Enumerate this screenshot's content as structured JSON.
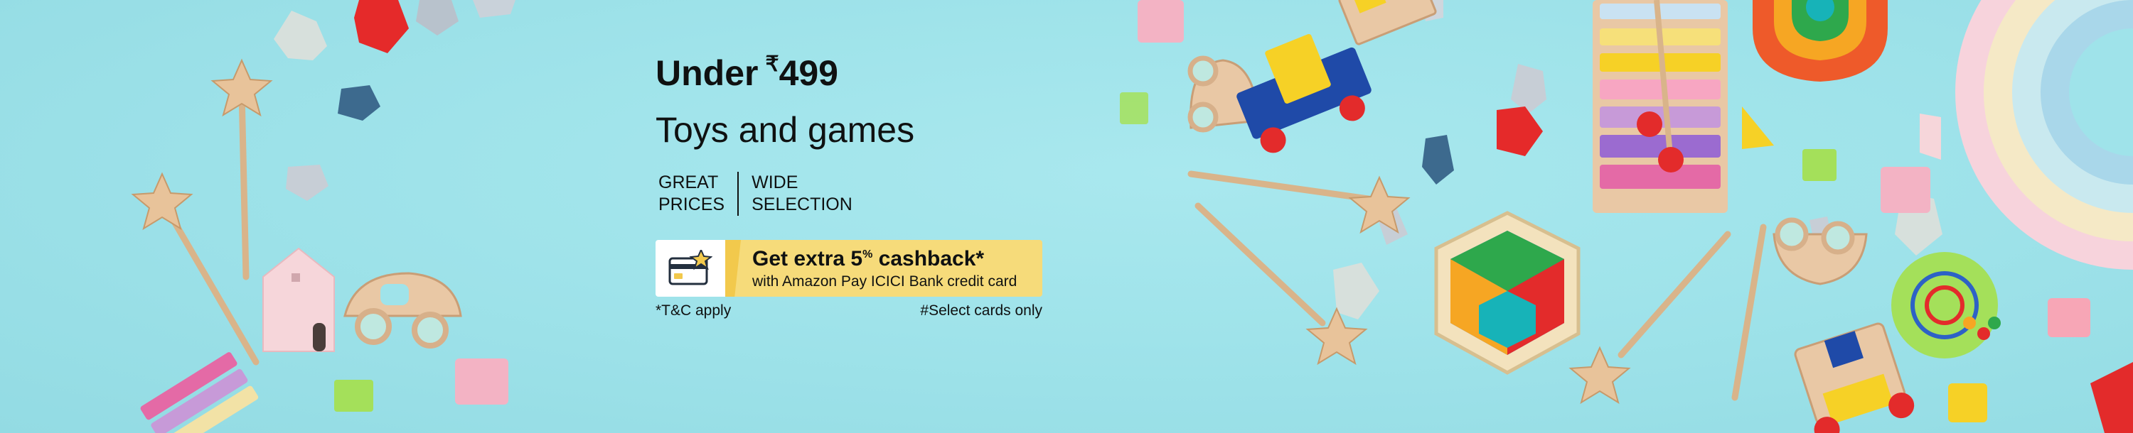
{
  "banner": {
    "price_prefix": "Under",
    "price_currency": "₹",
    "price_value": "499",
    "subtitle": "Toys and games",
    "features": [
      {
        "line1": "GREAT",
        "line2": "PRICES"
      },
      {
        "line1": "WIDE",
        "line2": "SELECTION"
      }
    ],
    "offer": {
      "title_prefix": "Get extra 5",
      "title_sup": "%",
      "title_suffix": " cashback*",
      "subtitle": "with Amazon Pay ICICI Bank credit card",
      "icon": "credit-card-star-icon"
    },
    "footnote_left": "*T&C apply",
    "footnote_right": "#Select cards only"
  },
  "colors": {
    "background": "#9fe3ea",
    "offer_fill": "#f6db7a",
    "offer_accent": "#f2c94c",
    "text": "#0f1111"
  },
  "decorations": [
    "star-wand-icon",
    "toy-car-icon",
    "toy-house-icon",
    "xylophone-icon",
    "toy-train-icon",
    "hexagon-puzzle-icon",
    "rainbow-stacker-icon",
    "bead-maze-icon",
    "wooden-block-icon",
    "gem-stone-icon"
  ]
}
